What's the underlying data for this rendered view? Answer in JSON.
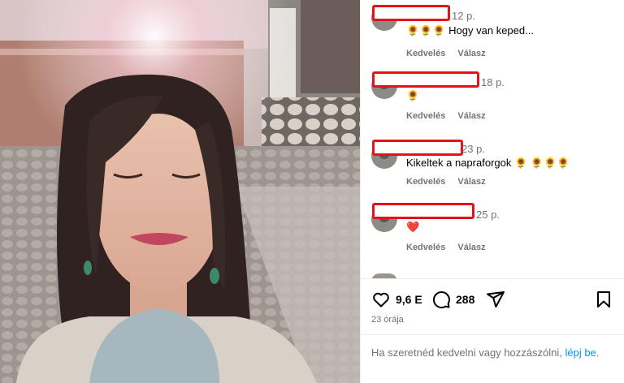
{
  "comments": [
    {
      "time": "12 p.",
      "text": "🌻🌻🌻 Hogy van keped...",
      "like_label": "Kedvelés",
      "reply_label": "Válasz"
    },
    {
      "time": "18 p.",
      "text": "🌻",
      "like_label": "Kedvelés",
      "reply_label": "Válasz"
    },
    {
      "time": "23 p.",
      "text": "Kikeltek a napraforgok 🌻 🌻🌻🌻",
      "like_label": "Kedvelés",
      "reply_label": "Válasz"
    },
    {
      "time": "25 p.",
      "text": "❤️",
      "like_label": "Kedvelés",
      "reply_label": "Válasz"
    }
  ],
  "stats": {
    "likes": "9,6 E",
    "comments": "288"
  },
  "posted": "23 órája",
  "login_prompt": {
    "text": "Ha szeretnéd kedvelni vagy hozzászólni, ",
    "link": "lépj be",
    "end": "."
  },
  "icons": {
    "like": "heart-icon",
    "comment": "comment-icon",
    "share": "share-icon",
    "save": "bookmark-icon"
  },
  "colors": {
    "redaction": "#e3121b",
    "link": "#0095f6",
    "muted": "#737373"
  }
}
